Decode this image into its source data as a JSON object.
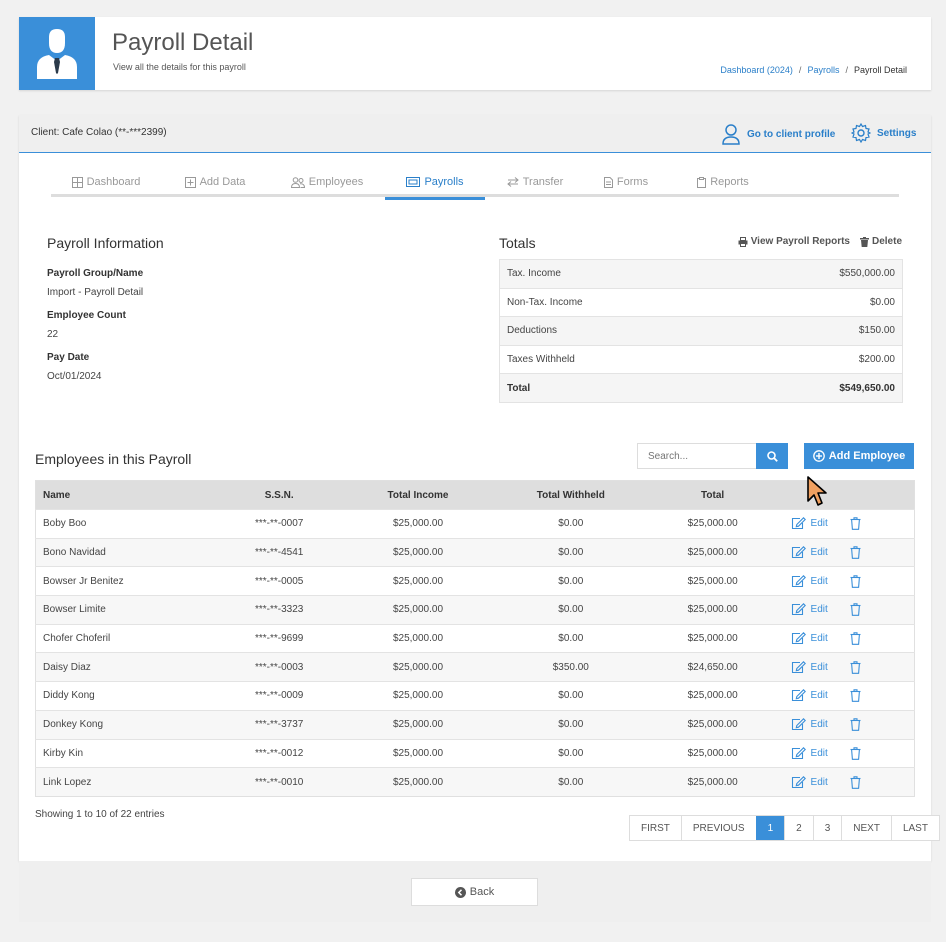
{
  "header": {
    "title": "Payroll Detail",
    "subtitle": "View all the details for this payroll",
    "breadcrumb": [
      "Dashboard (2024)",
      "Payrolls",
      "Payroll Detail"
    ]
  },
  "client_bar": {
    "client": "Client: Cafe Colao (**-***2399)",
    "profile_link": "Go to client profile",
    "settings_link": "Settings"
  },
  "tabs": [
    "Dashboard",
    "Add Data",
    "Employees",
    "Payrolls",
    "Transfer",
    "Forms",
    "Reports"
  ],
  "active_tab": "Payrolls",
  "payroll_info": {
    "title": "Payroll Information",
    "group_label": "Payroll Group/Name",
    "group_value": "Import - Payroll Detail",
    "count_label": "Employee Count",
    "count_value": "22",
    "date_label": "Pay Date",
    "date_value": "Oct/01/2024"
  },
  "totals": {
    "title": "Totals",
    "view_reports": "View Payroll Reports",
    "delete": "Delete",
    "rows": [
      {
        "label": "Tax. Income",
        "value": "$550,000.00"
      },
      {
        "label": "Non-Tax. Income",
        "value": "$0.00"
      },
      {
        "label": "Deductions",
        "value": "$150.00"
      },
      {
        "label": "Taxes Withheld",
        "value": "$200.00"
      },
      {
        "label": "Total",
        "value": "$549,650.00"
      }
    ]
  },
  "employees": {
    "title": "Employees in this Payroll",
    "search_placeholder": "Search...",
    "add_button": "Add Employee",
    "columns": [
      "Name",
      "S.S.N.",
      "Total Income",
      "Total Withheld",
      "Total"
    ],
    "edit_label": "Edit",
    "rows": [
      [
        "Boby Boo",
        "***-**-0007",
        "$25,000.00",
        "$0.00",
        "$25,000.00"
      ],
      [
        "Bono Navidad",
        "***-**-4541",
        "$25,000.00",
        "$0.00",
        "$25,000.00"
      ],
      [
        "Bowser Jr Benitez",
        "***-**-0005",
        "$25,000.00",
        "$0.00",
        "$25,000.00"
      ],
      [
        "Bowser Limite",
        "***-**-3323",
        "$25,000.00",
        "$0.00",
        "$25,000.00"
      ],
      [
        "Chofer Choferil",
        "***-**-9699",
        "$25,000.00",
        "$0.00",
        "$25,000.00"
      ],
      [
        "Daisy Diaz",
        "***-**-0003",
        "$25,000.00",
        "$350.00",
        "$24,650.00"
      ],
      [
        "Diddy Kong",
        "***-**-0009",
        "$25,000.00",
        "$0.00",
        "$25,000.00"
      ],
      [
        "Donkey Kong",
        "***-**-3737",
        "$25,000.00",
        "$0.00",
        "$25,000.00"
      ],
      [
        "Kirby Kin",
        "***-**-0012",
        "$25,000.00",
        "$0.00",
        "$25,000.00"
      ],
      [
        "Link Lopez",
        "***-**-0010",
        "$25,000.00",
        "$0.00",
        "$25,000.00"
      ]
    ],
    "showing": "Showing 1 to 10 of 22 entries",
    "pagination": [
      "FIRST",
      "PREVIOUS",
      "1",
      "2",
      "3",
      "NEXT",
      "LAST"
    ],
    "current_page": "1"
  },
  "footer": {
    "back": "Back"
  },
  "colors": {
    "accent": "#3a8fd9",
    "link": "#2a7fc9"
  }
}
